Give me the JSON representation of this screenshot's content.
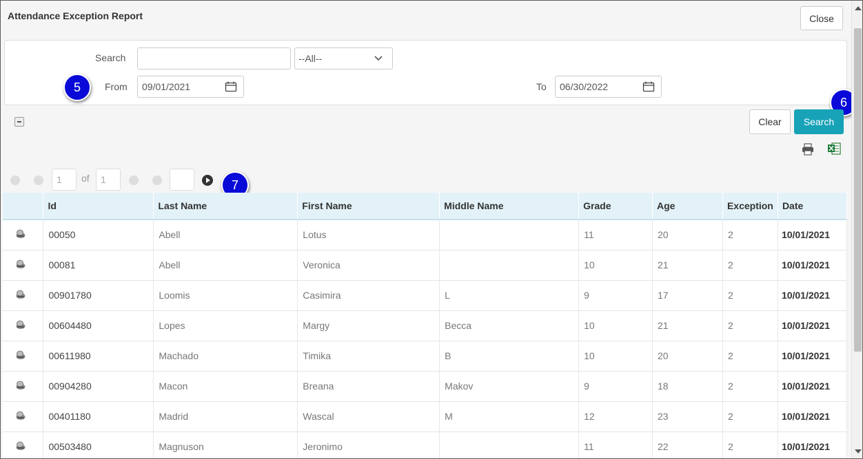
{
  "window": {
    "title": "Attendance Exception Report",
    "close_label": "Close"
  },
  "filters": {
    "search_label": "Search",
    "search_value": "",
    "dropdown_value": "--All--",
    "from_label": "From",
    "from_value": "09/01/2021",
    "to_label": "To",
    "to_value": "06/30/2022"
  },
  "badges": {
    "b5": "5",
    "b6": "6",
    "b7": "7"
  },
  "actions": {
    "clear_label": "Clear",
    "search_label": "Search"
  },
  "pager": {
    "page": "1",
    "of_label": "of",
    "total": "1",
    "goto": ""
  },
  "table": {
    "columns": [
      "Id",
      "Last Name",
      "First Name",
      "Middle Name",
      "Grade",
      "Age",
      "Exception",
      "Date"
    ],
    "rows": [
      [
        "00050",
        "Abell",
        "Lotus",
        "",
        "11",
        "20",
        "2",
        "10/01/2021"
      ],
      [
        "00081",
        "Abell",
        "Veronica",
        "",
        "10",
        "21",
        "2",
        "10/01/2021"
      ],
      [
        "00901780",
        "Loomis",
        "Casimira",
        "L",
        "9",
        "17",
        "2",
        "10/01/2021"
      ],
      [
        "00604480",
        "Lopes",
        "Margy",
        "Becca",
        "10",
        "21",
        "2",
        "10/01/2021"
      ],
      [
        "00611980",
        "Machado",
        "Timika",
        "B",
        "10",
        "20",
        "2",
        "10/01/2021"
      ],
      [
        "00904280",
        "Macon",
        "Breana",
        "Makov",
        "9",
        "18",
        "2",
        "10/01/2021"
      ],
      [
        "00401180",
        "Madrid",
        "Wascal",
        "M",
        "12",
        "23",
        "2",
        "10/01/2021"
      ],
      [
        "00503480",
        "Magnuson",
        "Jeronimo",
        "",
        "11",
        "22",
        "2",
        "10/01/2021"
      ]
    ]
  },
  "colors": {
    "accent": "#17a2b8",
    "badge": "#0a0ad8",
    "header_bg": "#e3f2f8"
  },
  "icons": [
    "calendar-icon",
    "chevron-down-icon",
    "printer-icon",
    "excel-icon",
    "student-row-icon",
    "pager-first-icon",
    "pager-prev-icon",
    "pager-next-icon",
    "pager-last-icon",
    "go-icon",
    "collapse-icon"
  ]
}
